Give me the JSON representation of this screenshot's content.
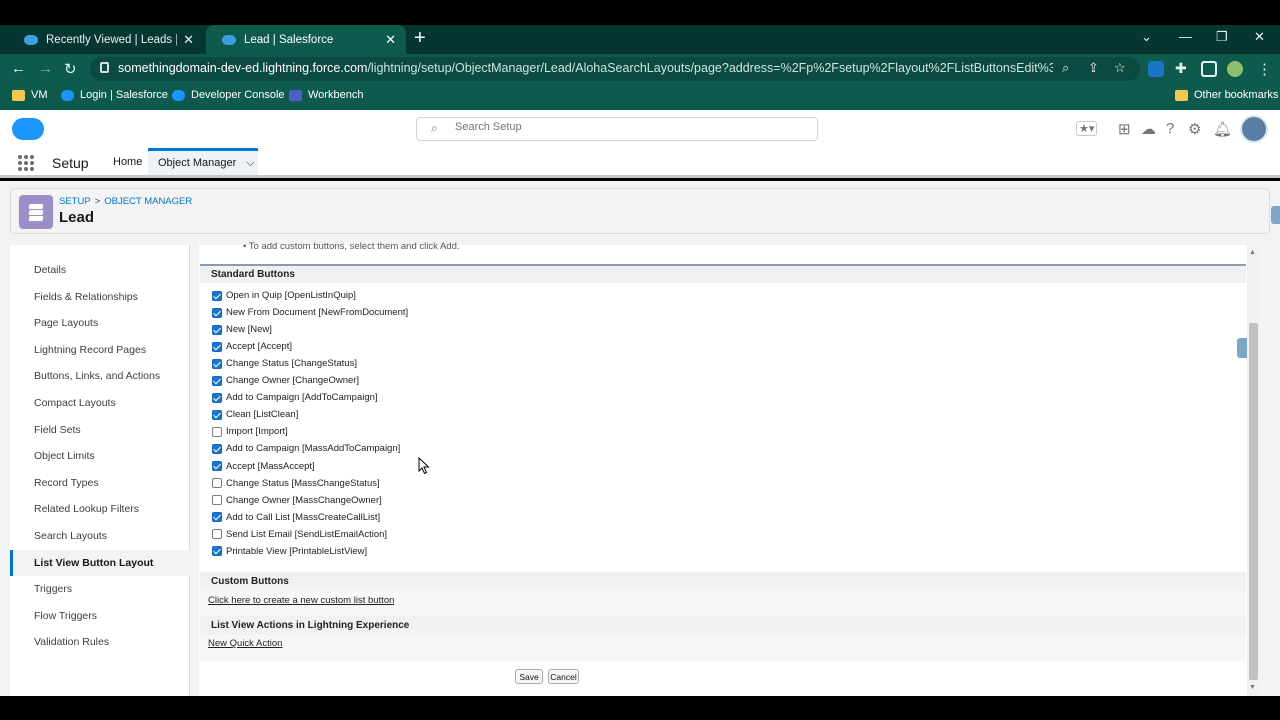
{
  "browser": {
    "tabs": [
      {
        "title": "Recently Viewed | Leads | Salesfo",
        "active": false
      },
      {
        "title": "Lead | Salesforce",
        "active": true
      }
    ],
    "url_host": "somethingdomain-dev-ed.lightning.force.com",
    "url_path": "/lightning/setup/ObjectManager/Lead/AlohaSearchLayouts/page?address=%2Fp%2Fsetup%2Flayout%2FListButtonsEdit%3FLayoutEn...",
    "bookmarks": [
      "VM",
      "Login | Salesforce",
      "Developer Console",
      "Workbench"
    ],
    "other_bookmarks": "Other bookmarks"
  },
  "header": {
    "search_placeholder": "Search Setup"
  },
  "appnav": {
    "app_name": "Setup",
    "home": "Home",
    "object_manager": "Object Manager"
  },
  "object": {
    "crumb_setup": "SETUP",
    "crumb_sep": ">",
    "crumb_om": "OBJECT MANAGER",
    "title": "Lead"
  },
  "leftnav": [
    "Details",
    "Fields & Relationships",
    "Page Layouts",
    "Lightning Record Pages",
    "Buttons, Links, and Actions",
    "Compact Layouts",
    "Field Sets",
    "Object Limits",
    "Record Types",
    "Related Lookup Filters",
    "Search Layouts",
    "List View Button Layout",
    "Triggers",
    "Flow Triggers",
    "Validation Rules"
  ],
  "leftnav_active": "List View Button Layout",
  "content": {
    "cut_text": "To add custom buttons, select them and click Add.",
    "standard_buttons_title": "Standard Buttons",
    "standard_buttons": [
      {
        "label": "Open in Quip [OpenListInQuip]",
        "checked": true
      },
      {
        "label": "New From Document [NewFromDocument]",
        "checked": true
      },
      {
        "label": "New [New]",
        "checked": true
      },
      {
        "label": "Accept [Accept]",
        "checked": true
      },
      {
        "label": "Change Status [ChangeStatus]",
        "checked": true
      },
      {
        "label": "Change Owner [ChangeOwner]",
        "checked": true
      },
      {
        "label": "Add to Campaign [AddToCampaign]",
        "checked": true
      },
      {
        "label": "Clean [ListClean]",
        "checked": true
      },
      {
        "label": "Import [Import]",
        "checked": false
      },
      {
        "label": "Add to Campaign [MassAddToCampaign]",
        "checked": true
      },
      {
        "label": "Accept [MassAccept]",
        "checked": true
      },
      {
        "label": "Change Status [MassChangeStatus]",
        "checked": false
      },
      {
        "label": "Change Owner [MassChangeOwner]",
        "checked": false
      },
      {
        "label": "Add to Call List [MassCreateCallList]",
        "checked": true
      },
      {
        "label": "Send List Email [SendListEmailAction]",
        "checked": false
      },
      {
        "label": "Printable View [PrintableListView]",
        "checked": true
      }
    ],
    "custom_buttons_title": "Custom Buttons",
    "custom_buttons_link": "Click here to create a new custom list button",
    "list_view_actions_title": "List View Actions in Lightning Experience",
    "new_quick_action": "New Quick Action",
    "save": "Save",
    "cancel": "Cancel"
  },
  "colors": {
    "chrome_dark": "#05362f",
    "chrome_toolbar": "#0e5b4e",
    "sf_blue": "#0176d3",
    "checkbox_blue": "#1976d2"
  }
}
